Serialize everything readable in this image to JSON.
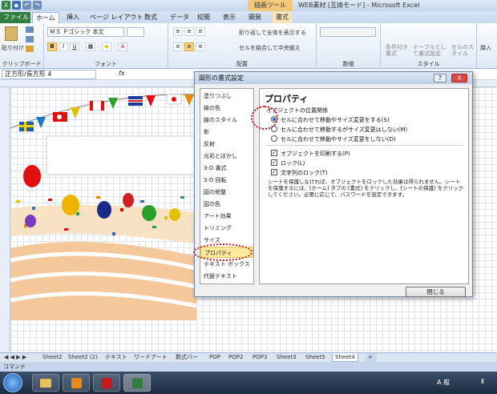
{
  "window": {
    "title": "WEB素材 [互換モード] - Microsoft Excel",
    "contextual_tab": "描画ツール"
  },
  "ribbon": {
    "tabs": [
      "ファイル",
      "ホーム",
      "挿入",
      "ページ レイアウト",
      "数式",
      "データ",
      "校閲",
      "表示",
      "開発",
      "書式"
    ],
    "active_tab": "ホーム",
    "clipboard": {
      "paste": "貼り付け",
      "label": "クリップボード"
    },
    "font": {
      "name": "ＭＳ Ｐゴシック 本文",
      "bold": "B",
      "italic": "I",
      "underline": "U",
      "label": "フォント"
    },
    "alignment": {
      "wrap": "折り返して全体を表示する",
      "merge": "セルを結合して中央揃え",
      "label": "配置"
    },
    "number": {
      "label": "数値"
    },
    "styles": {
      "conditional": "条件付き書式",
      "table": "テーブルとして書式設定",
      "cell": "セルのスタイル",
      "label": "スタイル"
    },
    "insert": {
      "label": "挿入"
    }
  },
  "formula_bar": {
    "name_box": "正方形/長方形 4",
    "fx": "fx"
  },
  "dialog": {
    "title": "図形の書式設定",
    "help": "?",
    "close_x": "X",
    "nav": [
      "塗りつぶし",
      "線の色",
      "線のスタイル",
      "影",
      "反射",
      "光彩とぼかし",
      "3-D 書式",
      "3-D 回転",
      "図の修整",
      "図の色",
      "アート効果",
      "トリミング",
      "サイズ",
      "プロパティ",
      "テキスト ボックス",
      "代替テキスト"
    ],
    "selected_nav": "プロパティ",
    "panel_title": "プロパティ",
    "position_group": "オブジェクトの位置関係",
    "radios": [
      {
        "label": "セルに合わせて移動やサイズ変更をする(S)",
        "checked": true
      },
      {
        "label": "セルに合わせて移動するがサイズ変更はしない(M)",
        "checked": false
      },
      {
        "label": "セルに合わせて移動やサイズ変更をしない(D)",
        "checked": false
      }
    ],
    "checkboxes": [
      {
        "label": "オブジェクトを印刷する(P)",
        "checked": true
      },
      {
        "label": "ロック(L)",
        "checked": true
      },
      {
        "label": "文字列のロック(T)",
        "checked": true
      }
    ],
    "note": "シートを保護しなければ、オブジェクトをロックした効果は得られません。シートを保護するには、[ホーム] タブの [書式] をクリックし、[シートの保護] をクリックしてください。必要に応じて、パスワードを設定できます。",
    "close_button": "閉じる"
  },
  "sheet_tabs": [
    "Sheet2",
    "Sheet2 (2)",
    "テキスト",
    "ワードアート",
    "数式バー",
    "POP",
    "POP2",
    "POP3",
    "Sheet3",
    "Sheet5",
    "Sheet4"
  ],
  "active_sheet": "Sheet4",
  "status": {
    "mode": "コマンド"
  },
  "taskbar": {
    "ime": "A 般",
    "tray": "Ⅱ"
  },
  "colors": {
    "file_tab": "#2f7f3f",
    "accent_red": "#cc1010",
    "selected_nav": "#fde89b",
    "contextual": "#f4c77a"
  }
}
